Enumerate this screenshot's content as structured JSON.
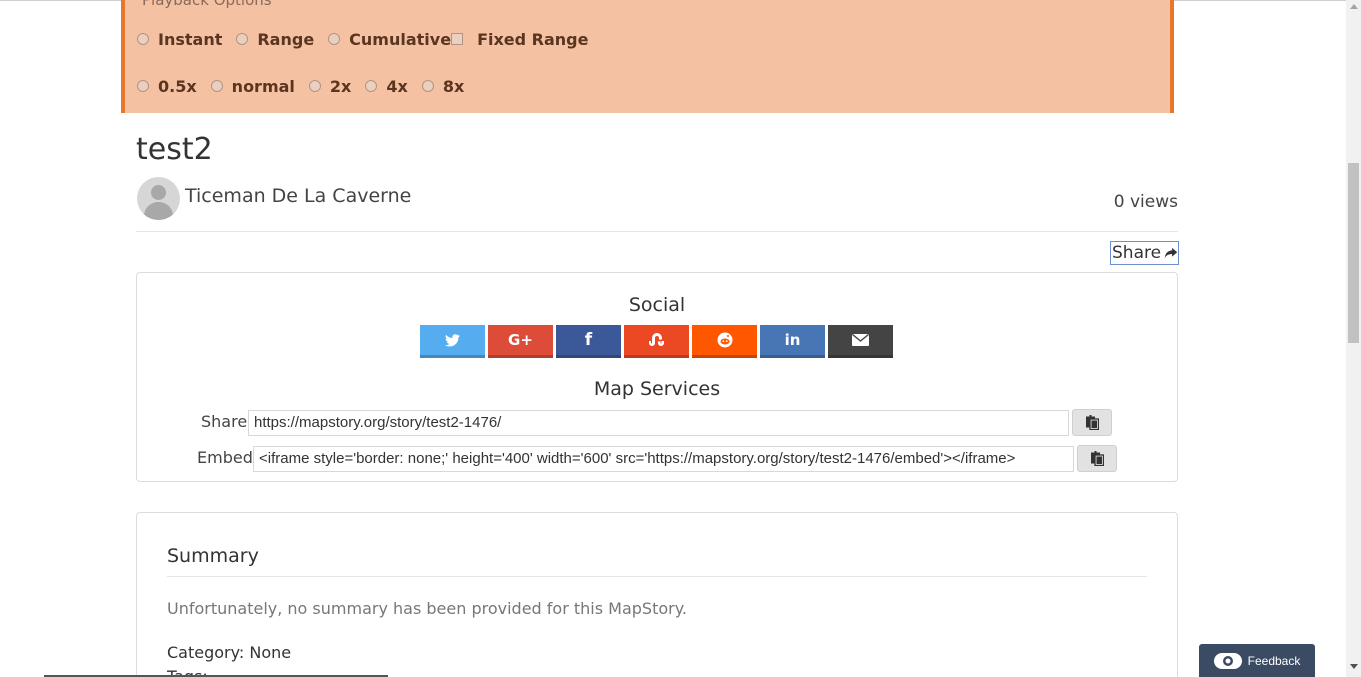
{
  "playback": {
    "title": "Playback Options",
    "modes": [
      "Instant",
      "Range",
      "Cumulative"
    ],
    "fixed_range": "Fixed Range",
    "speeds": [
      "0.5x",
      "normal",
      "2x",
      "4x",
      "8x"
    ]
  },
  "story": {
    "title": "test2",
    "author": "Ticeman De La Caverne",
    "views": "0 views"
  },
  "share": {
    "toggle_label": "Share",
    "social_title": "Social",
    "social_buttons": [
      {
        "name": "twitter",
        "icon": "twitter-icon",
        "color": "#55acee"
      },
      {
        "name": "google-plus",
        "icon": "google-plus-icon",
        "color": "#dd4b39"
      },
      {
        "name": "facebook",
        "icon": "facebook-icon",
        "color": "#3b5998"
      },
      {
        "name": "stumbleupon",
        "icon": "stumbleupon-icon",
        "color": "#eb4924"
      },
      {
        "name": "reddit",
        "icon": "reddit-icon",
        "color": "#ff5700"
      },
      {
        "name": "linkedin",
        "icon": "linkedin-icon",
        "color": "#4875b4"
      },
      {
        "name": "email",
        "icon": "envelope-icon",
        "color": "#444444"
      }
    ],
    "map_services_title": "Map Services",
    "share_label": "Share",
    "share_url": "https://mapstory.org/story/test2-1476/",
    "embed_label": "Embed",
    "embed_code": "<iframe style='border: none;' height='400' width='600' src='https://mapstory.org/story/test2-1476/embed'></iframe>"
  },
  "summary": {
    "title": "Summary",
    "text": "Unfortunately, no summary has been provided for this MapStory.",
    "category": "Category: None",
    "tags": "Tags:"
  },
  "feedback": {
    "label": "Feedback"
  },
  "colors": {
    "playback_bg": "#f4c2a3",
    "playback_border": "#e8762f",
    "feedback_bg": "#3b4b63"
  }
}
